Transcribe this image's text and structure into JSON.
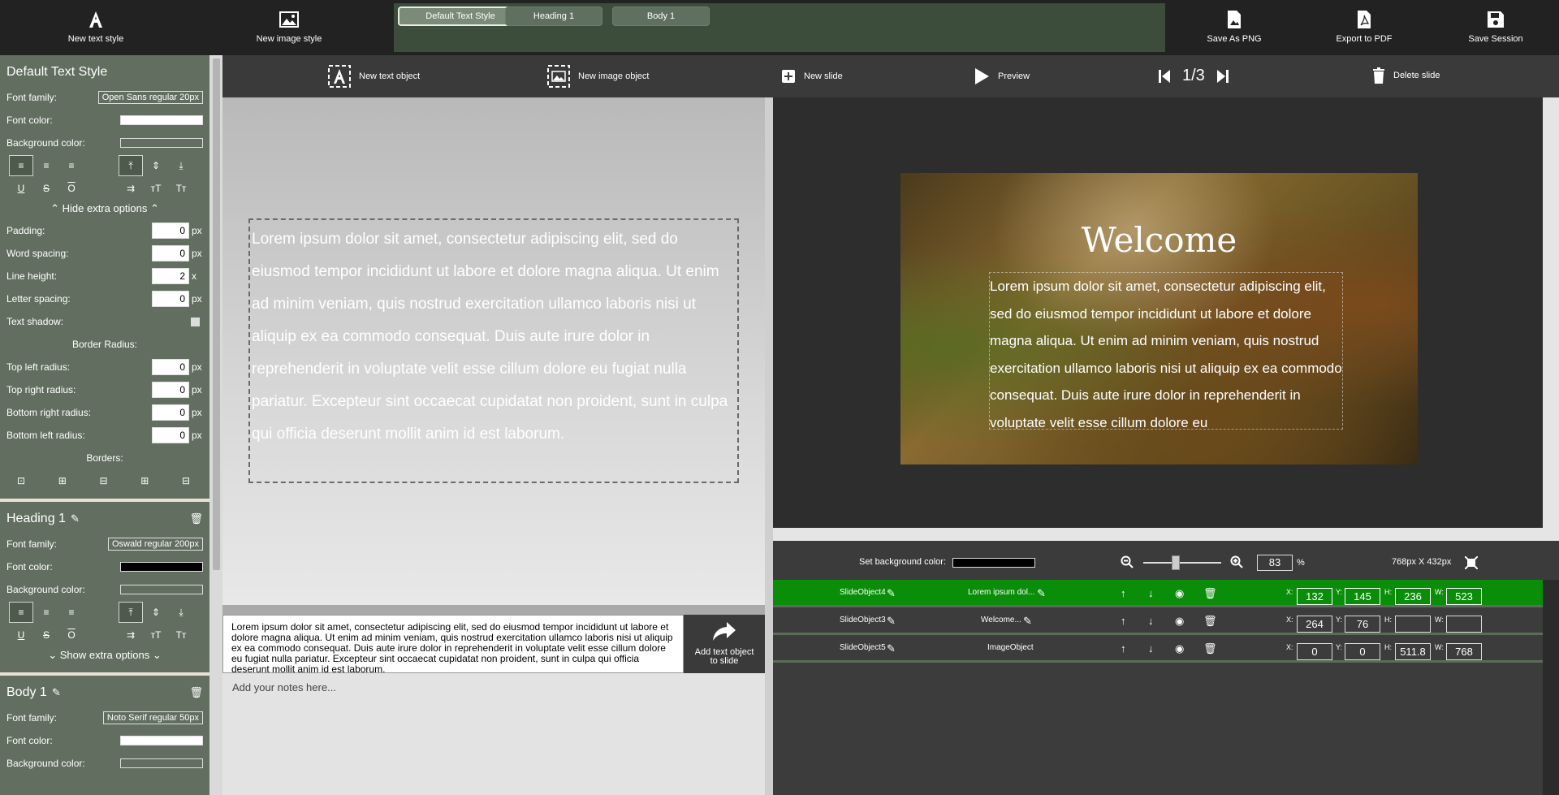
{
  "topbar": {
    "new_text_style": "New text style",
    "new_image_style": "New image style",
    "save_png": "Save As PNG",
    "export_pdf": "Export to PDF",
    "save_session": "Save Session",
    "style_tabs": [
      "Default Text Style",
      "Heading 1",
      "Body 1"
    ]
  },
  "sidebar": {
    "default_style": {
      "title": "Default Text Style",
      "font_family_label": "Font family:",
      "font_family": "Open Sans regular 20px",
      "font_color_label": "Font color:",
      "font_color": "#ffffff",
      "bg_color_label": "Background color:",
      "hide_extra": "Hide extra options",
      "padding_label": "Padding:",
      "padding": "0",
      "px": "px",
      "x": "x",
      "word_spacing_label": "Word spacing:",
      "word_spacing": "0",
      "line_height_label": "Line height:",
      "line_height": "2",
      "letter_spacing_label": "Letter spacing:",
      "letter_spacing": "0",
      "text_shadow_label": "Text shadow:",
      "border_radius_heading": "Border Radius:",
      "top_left_label": "Top left radius:",
      "top_left": "0",
      "top_right_label": "Top right radius:",
      "top_right": "0",
      "bottom_right_label": "Bottom right radius:",
      "bottom_right": "0",
      "bottom_left_label": "Bottom left radius:",
      "bottom_left": "0",
      "borders_heading": "Borders:"
    },
    "heading1": {
      "title": "Heading 1",
      "font_family_label": "Font family:",
      "font_family": "Oswald regular 200px",
      "font_color_label": "Font color:",
      "font_color": "#000000",
      "bg_color_label": "Background color:",
      "show_extra": "Show extra options"
    },
    "body1": {
      "title": "Body 1",
      "font_family_label": "Font family:",
      "font_family": "Noto Serif regular 50px",
      "font_color_label": "Font color:",
      "font_color": "#ffffff",
      "bg_color_label": "Background color:"
    }
  },
  "toolbar": {
    "new_text_object": "New text object",
    "new_image_object": "New image object",
    "new_slide": "New slide",
    "preview": "Preview",
    "slide_counter": "1/3",
    "delete_slide": "Delete slide"
  },
  "editor": {
    "text": "Lorem ipsum dolor sit amet, consectetur adipiscing elit, sed do eiusmod tempor incididunt ut labore et dolore magna aliqua. Ut enim ad minim veniam, quis nostrud exercitation ullamco laboris nisi ut aliquip ex ea commodo consequat. Duis aute irure dolor in reprehenderit in voluptate velit esse cillum dolore eu fugiat nulla pariatur. Excepteur sint occaecat cupidatat non proident, sunt in culpa qui officia deserunt mollit anim id est laborum.",
    "textarea": "Lorem ipsum dolor sit amet, consectetur adipiscing elit, sed do eiusmod tempor incididunt ut labore et dolore magna aliqua. Ut enim ad minim veniam, quis nostrud exercitation ullamco laboris nisi ut aliquip ex ea commodo consequat. Duis aute irure dolor in reprehenderit in voluptate velit esse cillum dolore eu fugiat nulla pariatur. Excepteur sint occaecat cupidatat non proident, sunt in culpa qui officia deserunt mollit anim id est laborum.",
    "add_to_slide": "Add text object to slide",
    "notes_placeholder": "Add your notes here..."
  },
  "slide": {
    "title": "Welcome",
    "body": "Lorem ipsum dolor sit amet, consectetur adipiscing elit, sed do eiusmod tempor incididunt ut labore et dolore magna aliqua. Ut enim ad minim veniam, quis nostrud exercitation ullamco laboris nisi ut aliquip ex ea commodo consequat. Duis aute irure dolor in reprehenderit in voluptate velit esse cillum dolore eu"
  },
  "controls": {
    "set_bg_label": "Set background color:",
    "bg_color": "#000000",
    "zoom": "83",
    "zoom_unit": "%",
    "slide_size": "768px X 432px"
  },
  "objects": [
    {
      "name": "SlideObject4",
      "content": "Lorem ipsum dol...",
      "x": "132",
      "y": "145",
      "h": "236",
      "w": "523",
      "selected": true
    },
    {
      "name": "SlideObject3",
      "content": "Welcome...",
      "x": "264",
      "y": "76",
      "h": "",
      "w": "",
      "selected": false
    },
    {
      "name": "SlideObject5",
      "content": "ImageObject",
      "x": "0",
      "y": "0",
      "h": "511.8",
      "w": "768",
      "selected": false
    }
  ],
  "field_labels": {
    "x": "X:",
    "y": "Y:",
    "h": "H:",
    "w": "W:"
  },
  "accent": "#0a8e0a"
}
